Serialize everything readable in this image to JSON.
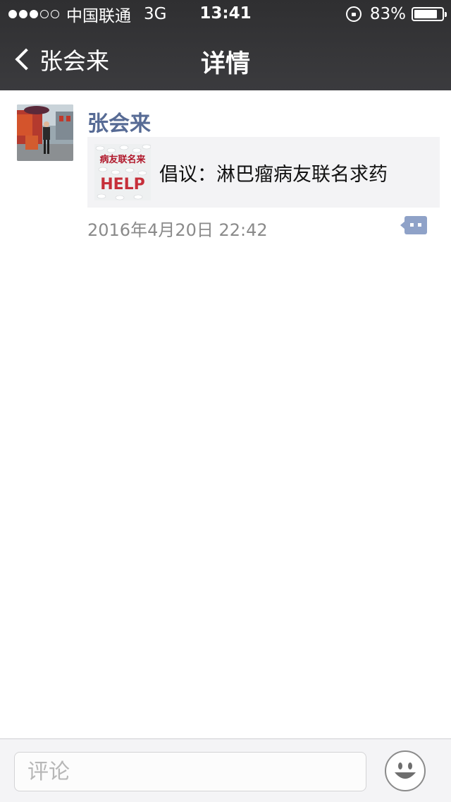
{
  "status_bar": {
    "carrier": "中国联通",
    "network": "3G",
    "time": "13:41",
    "battery": "83%",
    "battery_level": 0.83,
    "signal_bars_filled": 3,
    "signal_bars_total": 5
  },
  "nav": {
    "back_label": "张会来",
    "title": "详情",
    "icons": {
      "back": "chevron-left-icon"
    }
  },
  "post": {
    "author": "张会来",
    "share_card": {
      "title": "倡议：淋巴瘤病友联名求药",
      "thumbnail_label": "病友联名来",
      "thumbnail_text": "HELP"
    },
    "time": "2016年4月20日 22:42",
    "icons": {
      "comment": "comment-bubble-icon"
    }
  },
  "comment_bar": {
    "placeholder": "评论",
    "value": "",
    "icons": {
      "emoji": "smiley-face-icon"
    }
  },
  "colors": {
    "header_bg": "#343436",
    "link_blue": "#576b95",
    "comment_icon": "#8fa2c8",
    "card_bg": "#f3f3f5"
  }
}
